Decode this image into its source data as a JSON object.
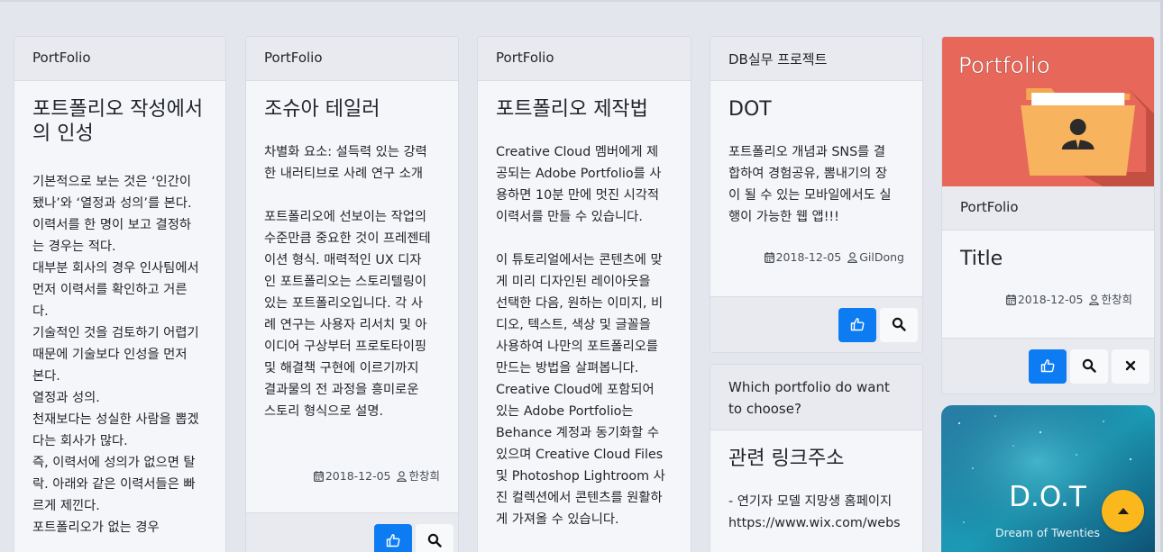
{
  "cards": [
    {
      "header": "PortFolio",
      "title": "포트폴리오 작성에서\n의 인성",
      "text": "기본적으로 보는 것은 ‘인간이\n됐나’와 ‘열정과 성의’를 본다.\n이력서를 한 명이 보고 결정하\n는 경우는 적다.\n대부분 회사의 경우 인사팀에서\n먼저 이력서를 확인하고 거른\n다.\n기술적인 것을 검토하기 어렵기\n때문에 기술보다 인성을 먼저\n본다.\n열정과 성의.\n천재보다는 성실한 사람을 뽑겠\n다는 회사가 많다.\n즉, 이력서에 성의가 없으면 탈\n락. 아래와 같은 이력서들은 빠\n르게 제낀다.\n포트폴리오가 없는 경우"
    },
    {
      "header": "PortFolio",
      "title": "조슈아 테일러",
      "text": "차별화 요소: 설득력 있는 강력\n한 내러티브로 사례 연구 소개\n\n포트폴리오에 선보이는 작업의\n수준만큼 중요한 것이 프레젠테\n이션 형식. 매력적인 UX 디자\n인 포트폴리오는 스토리텔링이\n있는 포트폴리오입니다. 각 사\n례 연구는 사용자 리서치 및 아\n이디어 구상부터 프로토타이핑\n및 해결책 구현에 이르기까지\n결과물의 전 과정을 흥미로운\n스토리 형식으로 설명.",
      "date": "2018-12-05",
      "author": "한창희"
    },
    {
      "header": "PortFolio",
      "title": "포트폴리오 제작법",
      "text": "Creative Cloud 멤버에게 제\n공되는 Adobe Portfolio를 사\n용하면 10분 만에 멋진 시각적\n이력서를 만들 수 있습니다.\n\n이 튜토리얼에서는 콘텐츠에 맞\n게 미리 디자인된 레이아웃을\n선택한 다음, 원하는 이미지, 비\n디오, 텍스트, 색상 및 글꼴을\n사용하여 나만의 포트폴리오를\n만드는 방법을 살펴봅니다.\nCreative Cloud에 포함되어\n있는 Adobe Portfolio는\nBehance 계정과 동기화할 수\n있으며 Creative Cloud Files\n및 Photoshop Lightroom 사\n진 컬렉션에서 콘텐츠를 원활하\n게 가져올 수 있습니다."
    },
    {
      "header": "DB실무 프로젝트",
      "title": "DOT",
      "text": "포트폴리오 개념과 SNS를 결\n합하여 경험공유, 뽐내기의 장\n이 될 수 있는 모바일에서도 실\n행이 가능한 웹 앱!!!",
      "date": "2018-12-05",
      "author": "GilDong"
    },
    {
      "header": "Which portfolio do want to choose?",
      "title": "관련 링크주소",
      "text": "- 연기자 모델 지망생 홈페이지\nhttps://www.wix.com/webs"
    },
    {
      "image_label": "Portfolio",
      "header": "PortFolio",
      "title": "Title",
      "date": "2018-12-05",
      "author": "한창희"
    },
    {
      "image_title": "D.O.T",
      "image_subtitle": "Dream of Twenties"
    }
  ],
  "icons": {
    "like": "thumbs-up-icon",
    "view": "search-icon",
    "delete": "close-icon",
    "calendar": "calendar-icon",
    "user": "user-icon",
    "scroll_top": "caret-up-icon"
  },
  "colors": {
    "primary": "#0d7cf2",
    "accent": "#fbb81d",
    "portfolio_thumb": "#e7685a"
  }
}
